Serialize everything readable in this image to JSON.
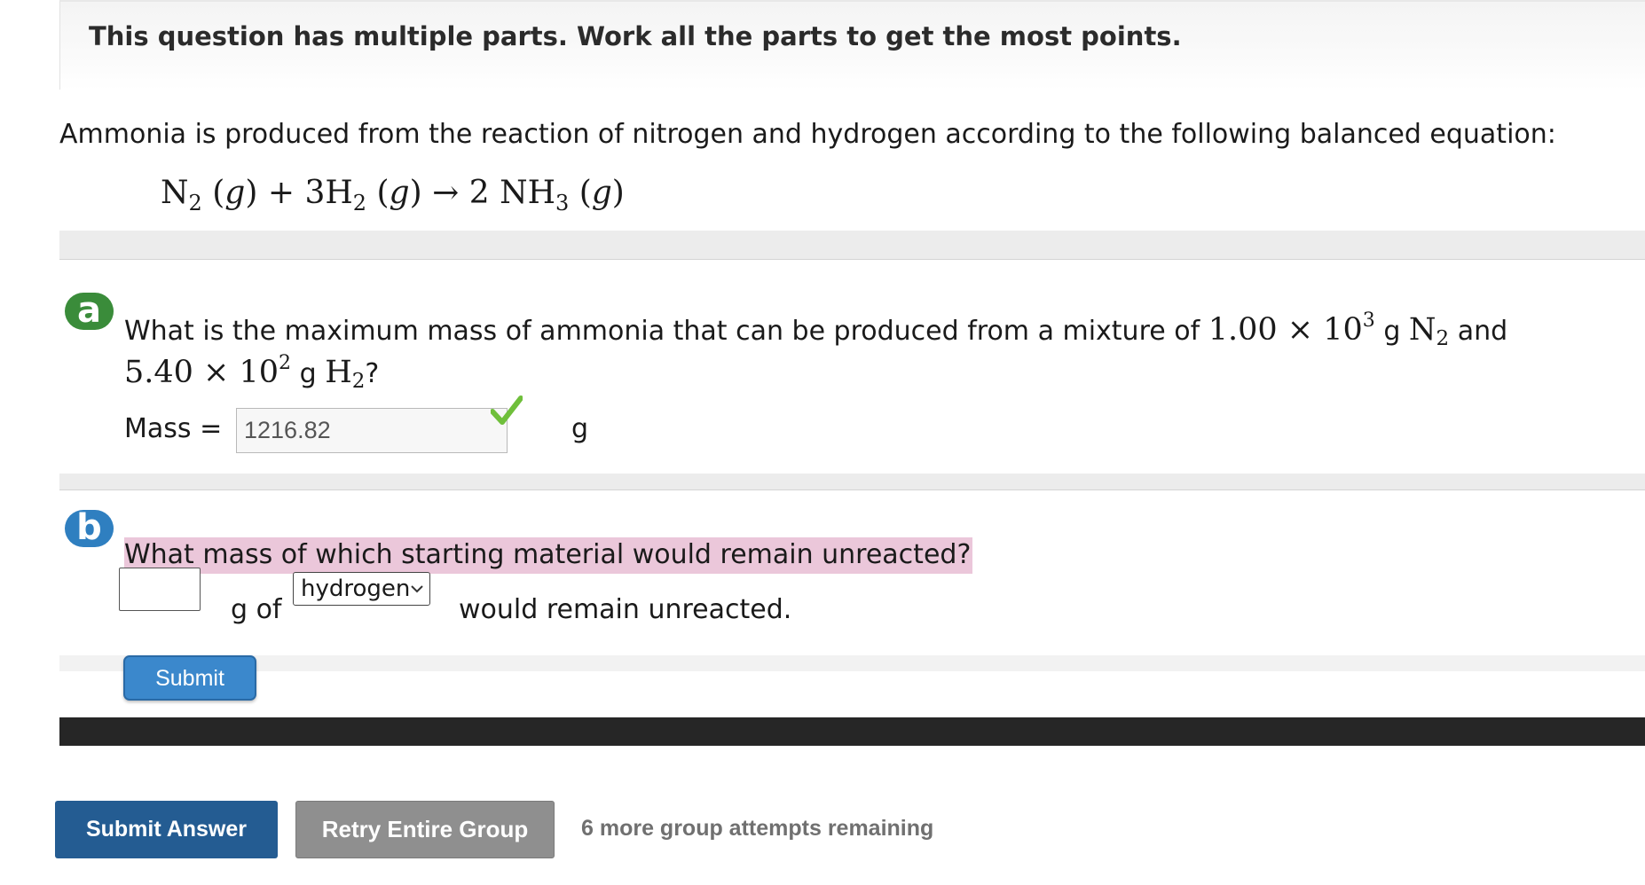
{
  "header": {
    "text": "This question has multiple parts. Work all the parts to get the most points."
  },
  "intro": {
    "text": "Ammonia is produced from the reaction of nitrogen and hydrogen according to the following balanced equation:"
  },
  "equation": {
    "n": "N",
    "n_sub": "2",
    "g": "g",
    "plus": "+",
    "h_coef": "3H",
    "h_sub": "2",
    "arrow": "→",
    "nh": "2 NH",
    "nh_sub": "3"
  },
  "part_a": {
    "badge": "a",
    "q_prefix": "What is the maximum mass of ammonia that can be produced from a mixture of",
    "n2_mass": "1.00 × 10",
    "n2_exp": "3",
    "unit_g": "g",
    "n2_formula": "N",
    "n2_sub": "2",
    "and": "and",
    "h2_mass": "5.40 × 10",
    "h2_exp": "2",
    "h2_formula": "H",
    "h2_sub": "2",
    "qmark": "?",
    "mass_label": "Mass =",
    "mass_value": "1216.82",
    "mass_unit": "g",
    "status_color": "#6fbf3b"
  },
  "part_b": {
    "badge": "b",
    "question": "What mass of which starting material would remain unreacted?",
    "g_of": "g of",
    "select_value": "hydrogen",
    "suffix": "would remain unreacted.",
    "submit_label": "Submit"
  },
  "footer": {
    "submit_answer": "Submit Answer",
    "retry": "Retry Entire Group",
    "attempts": "6 more group attempts remaining"
  }
}
